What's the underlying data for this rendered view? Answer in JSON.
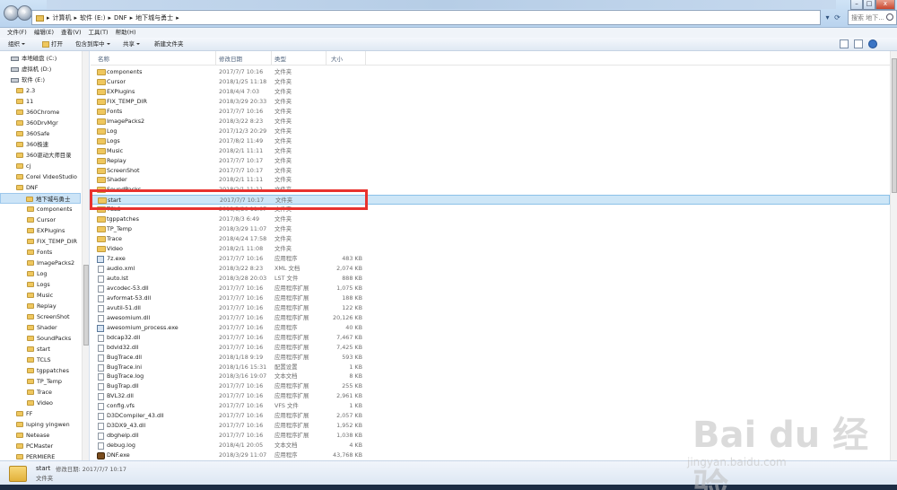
{
  "address_bar": {
    "breadcrumbs": [
      "计算机",
      "软件 (E:)",
      "DNF",
      "地下城与勇士"
    ],
    "search_placeholder": "搜索 地下..."
  },
  "window_controls": {
    "minimize": "–",
    "maximize": "□",
    "close": "x"
  },
  "menu": [
    "文件(F)",
    "编辑(E)",
    "查看(V)",
    "工具(T)",
    "帮助(H)"
  ],
  "toolbar": {
    "organize": "组织",
    "open": "打开",
    "include_in_library": "包含到库中",
    "share": "共享",
    "new_folder": "新建文件夹"
  },
  "nav_pane": {
    "items": [
      {
        "label": "本地磁盘 (C:)",
        "kind": "drive",
        "indent": 1
      },
      {
        "label": "虚拟机 (D:)",
        "kind": "drive",
        "indent": 1
      },
      {
        "label": "软件 (E:)",
        "kind": "drive",
        "indent": 1
      },
      {
        "label": "2.3",
        "kind": "folder",
        "indent": 2
      },
      {
        "label": "11",
        "kind": "folder",
        "indent": 2
      },
      {
        "label": "360Chrome",
        "kind": "folder",
        "indent": 2
      },
      {
        "label": "360DrvMgr",
        "kind": "folder",
        "indent": 2
      },
      {
        "label": "360Safe",
        "kind": "folder",
        "indent": 2
      },
      {
        "label": "360极速",
        "kind": "folder",
        "indent": 2
      },
      {
        "label": "360驱动大师目录",
        "kind": "folder",
        "indent": 2
      },
      {
        "label": "cj",
        "kind": "folder",
        "indent": 2
      },
      {
        "label": "Corel VideoStudio",
        "kind": "folder",
        "indent": 2
      },
      {
        "label": "DNF",
        "kind": "folder",
        "indent": 2
      },
      {
        "label": "地下城与勇士",
        "kind": "folder",
        "indent": 3,
        "selected": true
      },
      {
        "label": "components",
        "kind": "folder",
        "indent": 4
      },
      {
        "label": "Cursor",
        "kind": "folder",
        "indent": 4
      },
      {
        "label": "EXPlugins",
        "kind": "folder",
        "indent": 4
      },
      {
        "label": "FIX_TEMP_DIR",
        "kind": "folder",
        "indent": 4
      },
      {
        "label": "Fonts",
        "kind": "folder",
        "indent": 4
      },
      {
        "label": "ImagePacks2",
        "kind": "folder",
        "indent": 4
      },
      {
        "label": "Log",
        "kind": "folder",
        "indent": 4
      },
      {
        "label": "Logs",
        "kind": "folder",
        "indent": 4
      },
      {
        "label": "Music",
        "kind": "folder",
        "indent": 4
      },
      {
        "label": "Replay",
        "kind": "folder",
        "indent": 4
      },
      {
        "label": "ScreenShot",
        "kind": "folder",
        "indent": 4
      },
      {
        "label": "Shader",
        "kind": "folder",
        "indent": 4
      },
      {
        "label": "SoundPacks",
        "kind": "folder",
        "indent": 4
      },
      {
        "label": "start",
        "kind": "folder",
        "indent": 4
      },
      {
        "label": "TCLS",
        "kind": "folder",
        "indent": 4
      },
      {
        "label": "tgppatches",
        "kind": "folder",
        "indent": 4
      },
      {
        "label": "TP_Temp",
        "kind": "folder",
        "indent": 4
      },
      {
        "label": "Trace",
        "kind": "folder",
        "indent": 4
      },
      {
        "label": "Video",
        "kind": "folder",
        "indent": 4
      },
      {
        "label": "FF",
        "kind": "folder",
        "indent": 2
      },
      {
        "label": "luping yingwen",
        "kind": "folder",
        "indent": 2
      },
      {
        "label": "Netease",
        "kind": "folder",
        "indent": 2
      },
      {
        "label": "PCMaster",
        "kind": "folder",
        "indent": 2
      },
      {
        "label": "PERMIERE",
        "kind": "folder",
        "indent": 2
      }
    ]
  },
  "columns": {
    "name": "名称",
    "modified": "修改日期",
    "type": "类型",
    "size": "大小"
  },
  "files": [
    {
      "name": "components",
      "date": "2017/7/7 10:16",
      "type": "文件夹",
      "size": "",
      "icon": "folder"
    },
    {
      "name": "Cursor",
      "date": "2018/1/25 11:18",
      "type": "文件夹",
      "size": "",
      "icon": "folder"
    },
    {
      "name": "EXPlugins",
      "date": "2018/4/4 7:03",
      "type": "文件夹",
      "size": "",
      "icon": "folder"
    },
    {
      "name": "FIX_TEMP_DIR",
      "date": "2018/3/29 20:33",
      "type": "文件夹",
      "size": "",
      "icon": "folder"
    },
    {
      "name": "Fonts",
      "date": "2017/7/7 10:16",
      "type": "文件夹",
      "size": "",
      "icon": "folder"
    },
    {
      "name": "ImagePacks2",
      "date": "2018/3/22 8:23",
      "type": "文件夹",
      "size": "",
      "icon": "folder"
    },
    {
      "name": "Log",
      "date": "2017/12/3 20:29",
      "type": "文件夹",
      "size": "",
      "icon": "folder"
    },
    {
      "name": "Logs",
      "date": "2017/8/2 11:49",
      "type": "文件夹",
      "size": "",
      "icon": "folder"
    },
    {
      "name": "Music",
      "date": "2018/2/1 11:11",
      "type": "文件夹",
      "size": "",
      "icon": "folder"
    },
    {
      "name": "Replay",
      "date": "2017/7/7 10:17",
      "type": "文件夹",
      "size": "",
      "icon": "folder"
    },
    {
      "name": "ScreenShot",
      "date": "2017/7/7 10:17",
      "type": "文件夹",
      "size": "",
      "icon": "folder"
    },
    {
      "name": "Shader",
      "date": "2018/2/1 11:11",
      "type": "文件夹",
      "size": "",
      "icon": "folder"
    },
    {
      "name": "SoundPacks",
      "date": "2018/2/1 11:11",
      "type": "文件夹",
      "size": "",
      "icon": "folder"
    },
    {
      "name": "start",
      "date": "2017/7/7 10:17",
      "type": "文件夹",
      "size": "",
      "icon": "folder",
      "selected": true
    },
    {
      "name": "TCLS",
      "date": "2018/3/29 11:07",
      "type": "文件夹",
      "size": "",
      "icon": "folder"
    },
    {
      "name": "tgppatches",
      "date": "2017/8/3 6:49",
      "type": "文件夹",
      "size": "",
      "icon": "folder"
    },
    {
      "name": "TP_Temp",
      "date": "2018/3/29 11:07",
      "type": "文件夹",
      "size": "",
      "icon": "folder"
    },
    {
      "name": "Trace",
      "date": "2018/4/24 17:58",
      "type": "文件夹",
      "size": "",
      "icon": "folder"
    },
    {
      "name": "Video",
      "date": "2018/2/1 11:08",
      "type": "文件夹",
      "size": "",
      "icon": "folder"
    },
    {
      "name": "7z.exe",
      "date": "2017/7/7 10:16",
      "type": "应用程序",
      "size": "483 KB",
      "icon": "app"
    },
    {
      "name": "audio.xml",
      "date": "2018/3/22 8:23",
      "type": "XML 文档",
      "size": "2,074 KB",
      "icon": "file"
    },
    {
      "name": "auto.lst",
      "date": "2018/3/28 20:03",
      "type": "LST 文件",
      "size": "888 KB",
      "icon": "file"
    },
    {
      "name": "avcodec-53.dll",
      "date": "2017/7/7 10:16",
      "type": "应用程序扩展",
      "size": "1,075 KB",
      "icon": "file"
    },
    {
      "name": "avformat-53.dll",
      "date": "2017/7/7 10:16",
      "type": "应用程序扩展",
      "size": "188 KB",
      "icon": "file"
    },
    {
      "name": "avutil-51.dll",
      "date": "2017/7/7 10:16",
      "type": "应用程序扩展",
      "size": "122 KB",
      "icon": "file"
    },
    {
      "name": "awesomium.dll",
      "date": "2017/7/7 10:16",
      "type": "应用程序扩展",
      "size": "20,126 KB",
      "icon": "file"
    },
    {
      "name": "awesomium_process.exe",
      "date": "2017/7/7 10:16",
      "type": "应用程序",
      "size": "40 KB",
      "icon": "app"
    },
    {
      "name": "bdcap32.dll",
      "date": "2017/7/7 10:16",
      "type": "应用程序扩展",
      "size": "7,467 KB",
      "icon": "file"
    },
    {
      "name": "bdvid32.dll",
      "date": "2017/7/7 10:16",
      "type": "应用程序扩展",
      "size": "7,425 KB",
      "icon": "file"
    },
    {
      "name": "BugTrace.dll",
      "date": "2018/1/18 9:19",
      "type": "应用程序扩展",
      "size": "593 KB",
      "icon": "file"
    },
    {
      "name": "BugTrace.ini",
      "date": "2018/1/16 15:31",
      "type": "配置设置",
      "size": "1 KB",
      "icon": "file"
    },
    {
      "name": "BugTrace.log",
      "date": "2018/3/16 19:07",
      "type": "文本文档",
      "size": "8 KB",
      "icon": "file"
    },
    {
      "name": "BugTrap.dll",
      "date": "2017/7/7 10:16",
      "type": "应用程序扩展",
      "size": "255 KB",
      "icon": "file"
    },
    {
      "name": "BVL32.dll",
      "date": "2017/7/7 10:16",
      "type": "应用程序扩展",
      "size": "2,961 KB",
      "icon": "file"
    },
    {
      "name": "config.vfs",
      "date": "2017/7/7 10:16",
      "type": "VFS 文件",
      "size": "1 KB",
      "icon": "file"
    },
    {
      "name": "D3DCompiler_43.dll",
      "date": "2017/7/7 10:16",
      "type": "应用程序扩展",
      "size": "2,057 KB",
      "icon": "file"
    },
    {
      "name": "D3DX9_43.dll",
      "date": "2017/7/7 10:16",
      "type": "应用程序扩展",
      "size": "1,952 KB",
      "icon": "file"
    },
    {
      "name": "dbghelp.dll",
      "date": "2017/7/7 10:16",
      "type": "应用程序扩展",
      "size": "1,038 KB",
      "icon": "file"
    },
    {
      "name": "debug.log",
      "date": "2018/4/1 20:05",
      "type": "文本文档",
      "size": "4 KB",
      "icon": "file"
    },
    {
      "name": "DNF.exe",
      "date": "2018/3/29 11:07",
      "type": "应用程序",
      "size": "43,768 KB",
      "icon": "dnf"
    }
  ],
  "details_pane": {
    "name": "start",
    "modified_label": "修改日期: 2017/7/7 10:17",
    "type": "文件夹"
  },
  "watermark": {
    "logo": "Bai du 经验",
    "url": "jingyan.baidu.com"
  }
}
